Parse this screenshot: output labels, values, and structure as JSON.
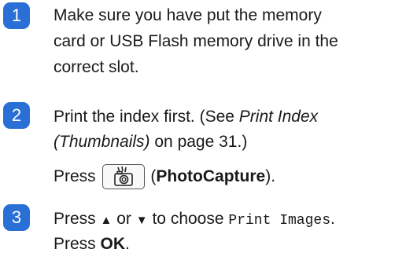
{
  "steps": [
    {
      "number": "1",
      "lines": [
        "Make sure you have put the memory",
        "card or USB Flash memory drive in the",
        "correct slot."
      ]
    },
    {
      "number": "2",
      "line1_a": "Print the index first. (See ",
      "line1_b": "Print Index",
      "line2_a": "(Thumbnails)",
      "line2_b": " on page 31.)",
      "press_label": "Press",
      "press_open": "(",
      "press_button": "PhotoCapture",
      "press_close": ")."
    },
    {
      "number": "3",
      "line1_a": "Press",
      "up_arrow": "▲",
      "line1_or": "or",
      "down_arrow": "▼",
      "line1_b": "to choose",
      "line1_mono": "Print Images",
      "line1_end": ".",
      "line2_a": "Press ",
      "line2_b": "OK",
      "line2_c": "."
    }
  ],
  "icons": {
    "photocapture_button": "camera-icon",
    "badge_color": "#2a6fd6"
  }
}
